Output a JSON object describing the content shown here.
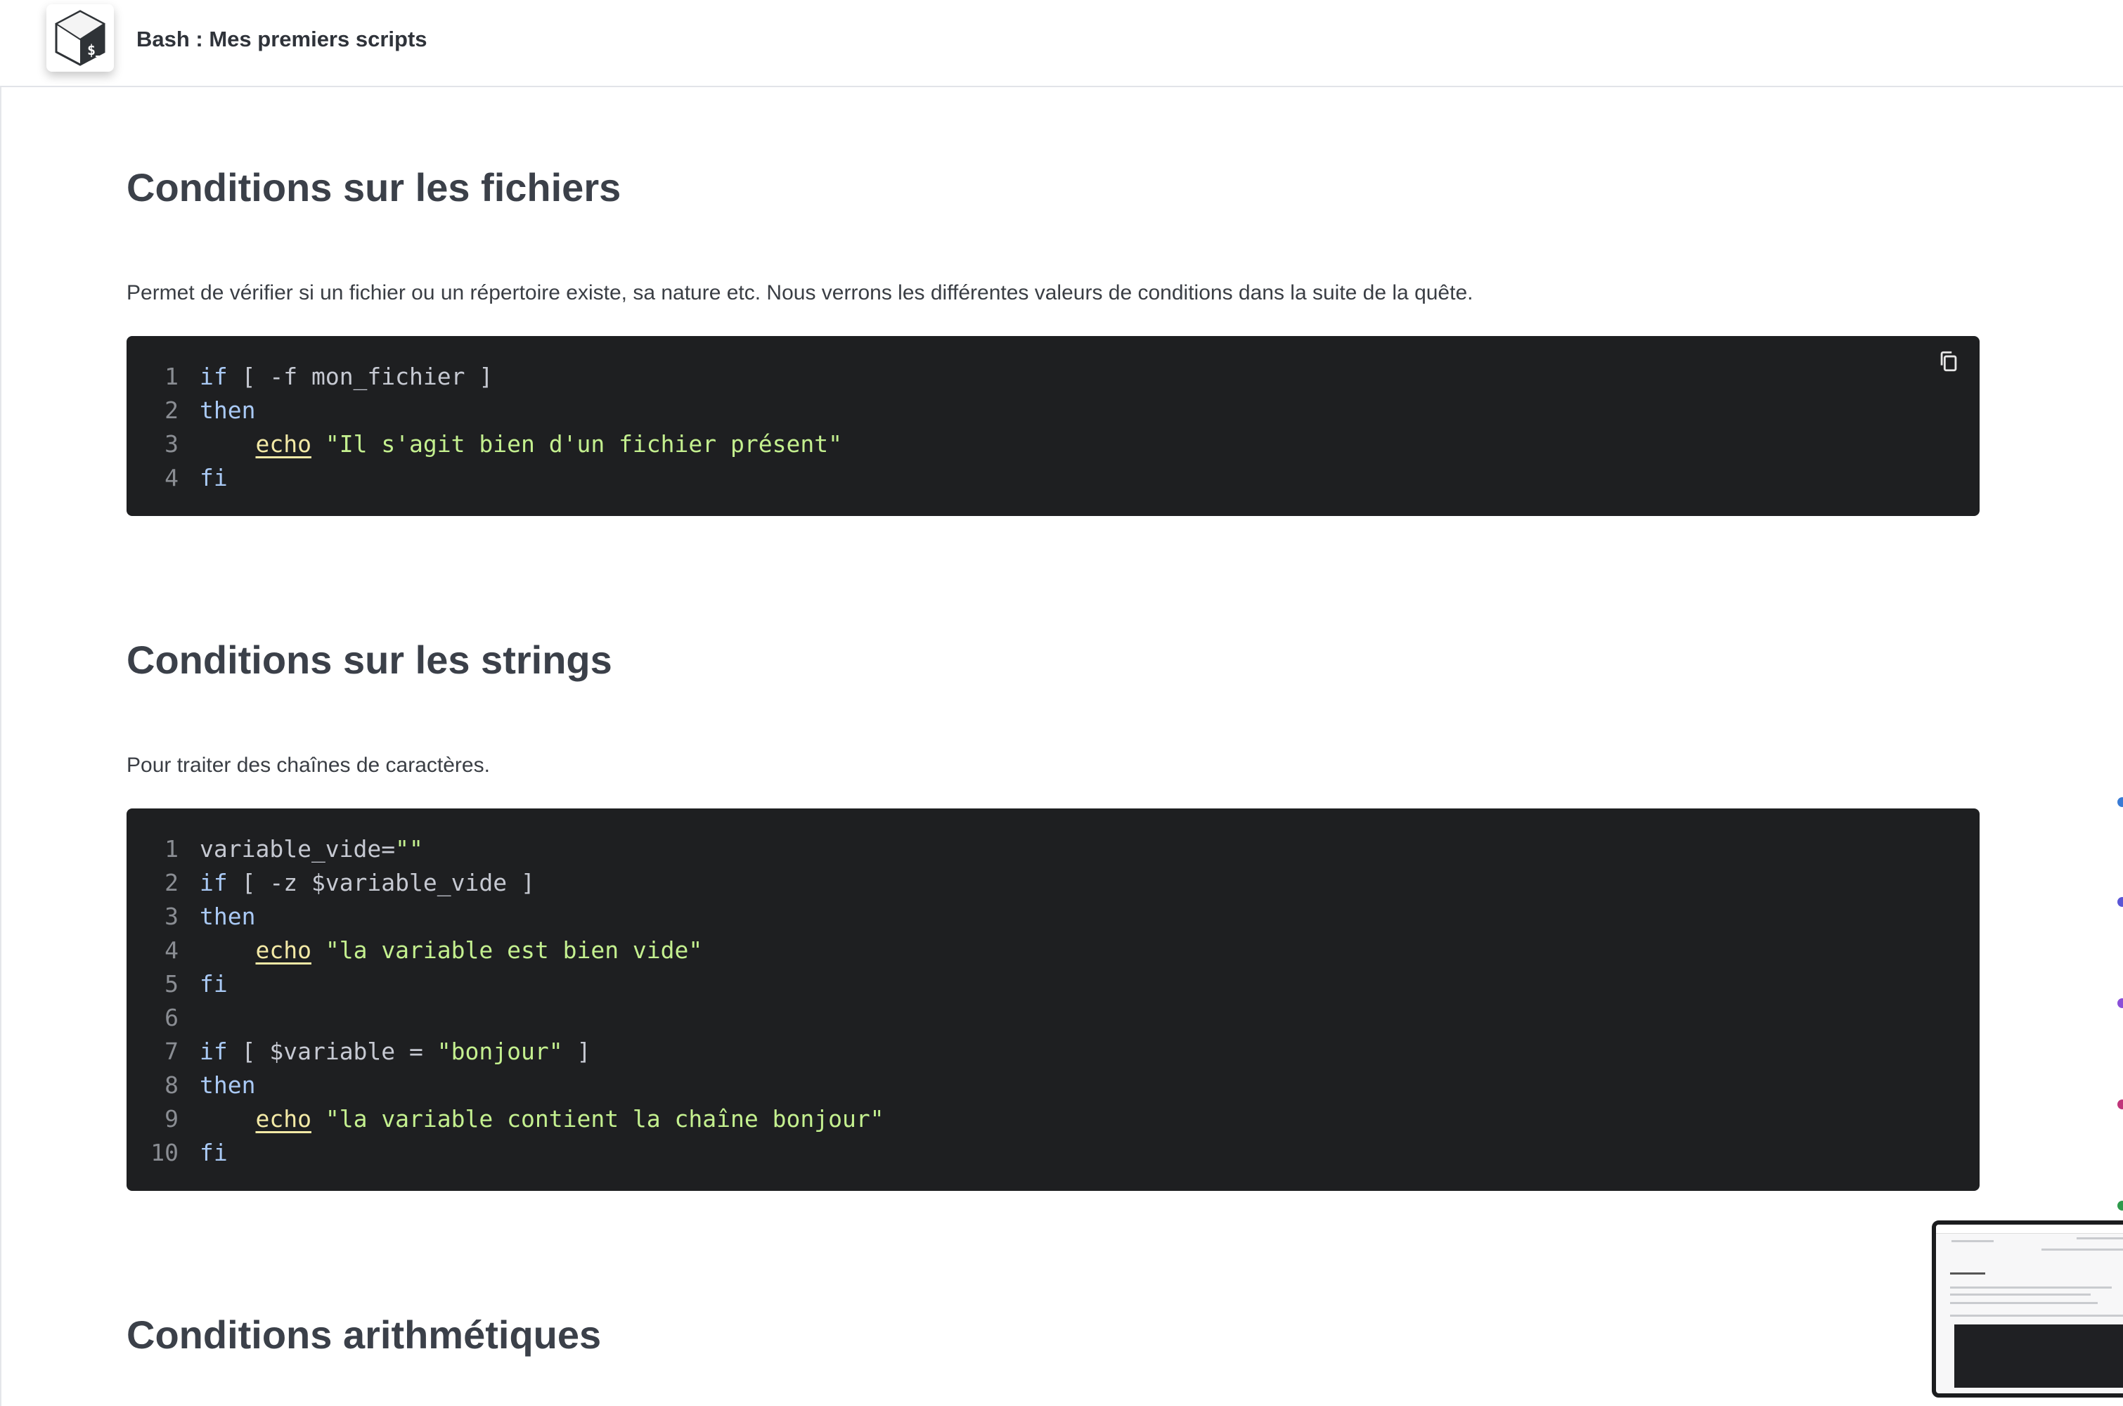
{
  "header": {
    "title": "Bash : Mes premiers scripts",
    "logo_icon": "bash-shell-logo-icon"
  },
  "sections": [
    {
      "title": "Conditions sur les fichiers",
      "description": "Permet de vérifier si un fichier ou un répertoire existe, sa nature etc. Nous verrons les différentes valeurs de conditions dans la suite de la quête.",
      "copy_icon": "copy-icon",
      "code": [
        {
          "n": "1",
          "parts": [
            {
              "t": "if",
              "c": "kw"
            },
            {
              "t": " [ -f mon_fichier ]",
              "c": "plain"
            }
          ]
        },
        {
          "n": "2",
          "parts": [
            {
              "t": "then",
              "c": "kw"
            }
          ]
        },
        {
          "n": "3",
          "parts": [
            {
              "t": "    ",
              "c": "plain"
            },
            {
              "t": "echo",
              "c": "cmd"
            },
            {
              "t": " ",
              "c": "plain"
            },
            {
              "t": "\"Il s'agit bien d'un fichier présent\"",
              "c": "str"
            }
          ]
        },
        {
          "n": "4",
          "parts": [
            {
              "t": "fi",
              "c": "kw"
            }
          ]
        }
      ]
    },
    {
      "title": "Conditions sur les strings",
      "description": "Pour traiter des chaînes de caractères.",
      "code": [
        {
          "n": "1",
          "parts": [
            {
              "t": "variable_vide=",
              "c": "plain"
            },
            {
              "t": "\"\"",
              "c": "str"
            }
          ]
        },
        {
          "n": "2",
          "parts": [
            {
              "t": "if",
              "c": "kw"
            },
            {
              "t": " [ -z $variable_vide ]",
              "c": "plain"
            }
          ]
        },
        {
          "n": "3",
          "parts": [
            {
              "t": "then",
              "c": "kw"
            }
          ]
        },
        {
          "n": "4",
          "parts": [
            {
              "t": "    ",
              "c": "plain"
            },
            {
              "t": "echo",
              "c": "cmd"
            },
            {
              "t": " ",
              "c": "plain"
            },
            {
              "t": "\"la variable est bien vide\"",
              "c": "str"
            }
          ]
        },
        {
          "n": "5",
          "parts": [
            {
              "t": "fi",
              "c": "kw"
            }
          ]
        },
        {
          "n": "6",
          "parts": []
        },
        {
          "n": "7",
          "parts": [
            {
              "t": "if",
              "c": "kw"
            },
            {
              "t": " [ $variable = ",
              "c": "plain"
            },
            {
              "t": "\"bonjour\"",
              "c": "str"
            },
            {
              "t": " ]",
              "c": "plain"
            }
          ]
        },
        {
          "n": "8",
          "parts": [
            {
              "t": "then",
              "c": "kw"
            }
          ]
        },
        {
          "n": "9",
          "parts": [
            {
              "t": "    ",
              "c": "plain"
            },
            {
              "t": "echo",
              "c": "cmd"
            },
            {
              "t": " ",
              "c": "plain"
            },
            {
              "t": "\"la variable contient la chaîne bonjour\"",
              "c": "str"
            }
          ]
        },
        {
          "n": "10",
          "parts": [
            {
              "t": "fi",
              "c": "kw"
            }
          ]
        }
      ]
    },
    {
      "title": "Conditions arithmétiques"
    }
  ],
  "floating_preview": {
    "icon": "page-preview-thumbnail"
  },
  "colors": {
    "code_bg": "#1e1f21",
    "keyword": "#a9c9f5",
    "string": "#c4f08f",
    "command": "#f3e9a6",
    "line_number": "#8a8d93"
  }
}
